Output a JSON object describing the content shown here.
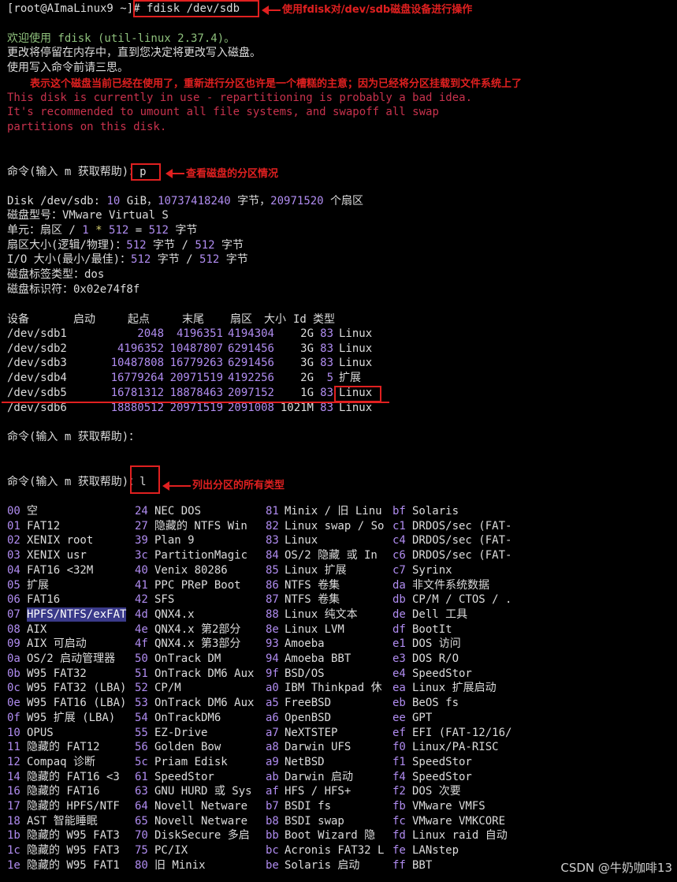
{
  "prompt": {
    "text": "[root@AImaLinux9 ~]# ",
    "command": "fdisk /dev/sdb"
  },
  "ann_fdisk": "使用fdisk对/dev/sdb磁盘设备进行操作",
  "welcome": {
    "l1": "欢迎使用 fdisk (util-linux 2.37.4)。",
    "l2": "更改将停留在内存中，直到您决定将更改写入磁盘。",
    "l3": "使用写入命令前请三思。"
  },
  "ann_inuse": "表示这个磁盘当前已经在使用了，重新进行分区也许是一个槽糕的主意；因为已经将分区挂载到文件系统上了",
  "warning": {
    "l1": "This disk is currently in use - repartitioning is probably a bad idea.",
    "l2": "It's recommended to umount all file systems, and swapoff all swap",
    "l3": "partitions on this disk."
  },
  "cmd_prompt": "命令(输入 m 获取帮助)：",
  "cmd_p": "p",
  "ann_p": "查看磁盘的分区情况",
  "disk_info": {
    "size_label": "Disk /dev/sdb: ",
    "size_gib": "10",
    "size_unit": " GiB，",
    "bytes": "10737418240",
    "bytes_unit": " 字节，",
    "sectors": "20971520",
    "sectors_unit": " 个扇区",
    "model_label": "磁盘型号：",
    "model": "VMware Virtual S",
    "units_label": "单元：扇区 / ",
    "units_1": "1",
    "units_mul": " * ",
    "units_512a": "512",
    "units_eq": " = ",
    "units_512b": "512",
    "units_unit": " 字节",
    "sector_label": "扇区大小(逻辑/物理)：",
    "sector_a": "512",
    "sector_mid": " 字节 / ",
    "sector_b": "512",
    "sector_unit": " 字节",
    "io_label": "I/O 大小(最小/最佳)：",
    "io_a": "512",
    "io_mid": " 字节 / ",
    "io_b": "512",
    "io_unit": " 字节",
    "label_type": "磁盘标签类型：dos",
    "identifier": "磁盘标识符：0x02e74f8f"
  },
  "partition_table": {
    "headers": [
      "设备",
      "启动",
      "起点",
      "末尾",
      "扇区",
      "大小",
      "Id",
      "类型"
    ],
    "rows": [
      {
        "device": "/dev/sdb1",
        "start": "2048",
        "end": "4196351",
        "sectors": "4194304",
        "size": "2G",
        "id": "83",
        "type": "Linux"
      },
      {
        "device": "/dev/sdb2",
        "start": "4196352",
        "end": "10487807",
        "sectors": "6291456",
        "size": "3G",
        "id": "83",
        "type": "Linux"
      },
      {
        "device": "/dev/sdb3",
        "start": "10487808",
        "end": "16779263",
        "sectors": "6291456",
        "size": "3G",
        "id": "83",
        "type": "Linux"
      },
      {
        "device": "/dev/sdb4",
        "start": "16779264",
        "end": "20971519",
        "sectors": "4192256",
        "size": "2G",
        "id": "5",
        "type": "扩展"
      },
      {
        "device": "/dev/sdb5",
        "start": "16781312",
        "end": "18878463",
        "sectors": "2097152",
        "size": "1G",
        "id": "83",
        "type": "Linux"
      },
      {
        "device": "/dev/sdb6",
        "start": "18880512",
        "end": "20971519",
        "sectors": "2091008",
        "size": "1021M",
        "id": "83",
        "type": "Linux"
      }
    ]
  },
  "cmd_l": "l",
  "ann_l": "列出分区的所有类型",
  "types": [
    [
      "00",
      "空",
      "24",
      "NEC DOS",
      "81",
      "Minix / 旧 Linu",
      "bf",
      "Solaris"
    ],
    [
      "01",
      "FAT12",
      "27",
      "隐藏的 NTFS Win",
      "82",
      "Linux swap / So",
      "c1",
      "DRDOS/sec (FAT-"
    ],
    [
      "02",
      "XENIX root",
      "39",
      "Plan 9",
      "83",
      "Linux",
      "c4",
      "DRDOS/sec (FAT-"
    ],
    [
      "03",
      "XENIX usr",
      "3c",
      "PartitionMagic",
      "84",
      "OS/2 隐藏 或 In",
      "c6",
      "DRDOS/sec (FAT-"
    ],
    [
      "04",
      "FAT16 <32M",
      "40",
      "Venix 80286",
      "85",
      "Linux 扩展",
      "c7",
      "Syrinx"
    ],
    [
      "05",
      "扩展",
      "41",
      "PPC PReP Boot",
      "86",
      "NTFS 卷集",
      "da",
      "非文件系统数据"
    ],
    [
      "06",
      "FAT16",
      "42",
      "SFS",
      "87",
      "NTFS 卷集",
      "db",
      "CP/M / CTOS / ."
    ],
    [
      "07",
      "HPFS/NTFS/exFAT",
      "4d",
      "QNX4.x",
      "88",
      "Linux 纯文本",
      "de",
      "Dell 工具"
    ],
    [
      "08",
      "AIX",
      "4e",
      "QNX4.x 第2部分",
      "8e",
      "Linux LVM",
      "df",
      "BootIt"
    ],
    [
      "09",
      "AIX 可启动",
      "4f",
      "QNX4.x 第3部分",
      "93",
      "Amoeba",
      "e1",
      "DOS 访问"
    ],
    [
      "0a",
      "OS/2 启动管理器",
      "50",
      "OnTrack DM",
      "94",
      "Amoeba BBT",
      "e3",
      "DOS R/O"
    ],
    [
      "0b",
      "W95 FAT32",
      "51",
      "OnTrack DM6 Aux",
      "9f",
      "BSD/OS",
      "e4",
      "SpeedStor"
    ],
    [
      "0c",
      "W95 FAT32 (LBA)",
      "52",
      "CP/M",
      "a0",
      "IBM Thinkpad 休",
      "ea",
      "Linux 扩展启动"
    ],
    [
      "0e",
      "W95 FAT16 (LBA)",
      "53",
      "OnTrack DM6 Aux",
      "a5",
      "FreeBSD",
      "eb",
      "BeOS fs"
    ],
    [
      "0f",
      "W95 扩展 (LBA)",
      "54",
      "OnTrackDM6",
      "a6",
      "OpenBSD",
      "ee",
      "GPT"
    ],
    [
      "10",
      "OPUS",
      "55",
      "EZ-Drive",
      "a7",
      "NeXTSTEP",
      "ef",
      "EFI (FAT-12/16/"
    ],
    [
      "11",
      "隐藏的 FAT12",
      "56",
      "Golden Bow",
      "a8",
      "Darwin UFS",
      "f0",
      "Linux/PA-RISC"
    ],
    [
      "12",
      "Compaq 诊断",
      "5c",
      "Priam Edisk",
      "a9",
      "NetBSD",
      "f1",
      "SpeedStor"
    ],
    [
      "14",
      "隐藏的 FAT16 <3",
      "61",
      "SpeedStor",
      "ab",
      "Darwin 启动",
      "f4",
      "SpeedStor"
    ],
    [
      "16",
      "隐藏的 FAT16",
      "63",
      "GNU HURD 或 Sys",
      "af",
      "HFS / HFS+",
      "f2",
      "DOS 次要"
    ],
    [
      "17",
      "隐藏的 HPFS/NTF",
      "64",
      "Novell Netware",
      "b7",
      "BSDI fs",
      "fb",
      "VMware VMFS"
    ],
    [
      "18",
      "AST 智能睡眠",
      "65",
      "Novell Netware",
      "b8",
      "BSDI swap",
      "fc",
      "VMware VMKCORE"
    ],
    [
      "1b",
      "隐藏的 W95 FAT3",
      "70",
      "DiskSecure 多启",
      "bb",
      "Boot Wizard 隐",
      "fd",
      "Linux raid 自动"
    ],
    [
      "1c",
      "隐藏的 W95 FAT3",
      "75",
      "PC/IX",
      "bc",
      "Acronis FAT32 L",
      "fe",
      "LANstep"
    ],
    [
      "1e",
      "隐藏的 W95 FAT1",
      "80",
      "旧 Minix",
      "be",
      "Solaris 启动",
      "ff",
      "BBT"
    ]
  ],
  "watermark": "CSDN @牛奶咖啡13",
  "colors": {
    "green": "#8ec07c",
    "purple": "#b08cf0",
    "red_text": "#c8324d",
    "annotation": "#e02020",
    "highlight": "#3a3a8a"
  }
}
